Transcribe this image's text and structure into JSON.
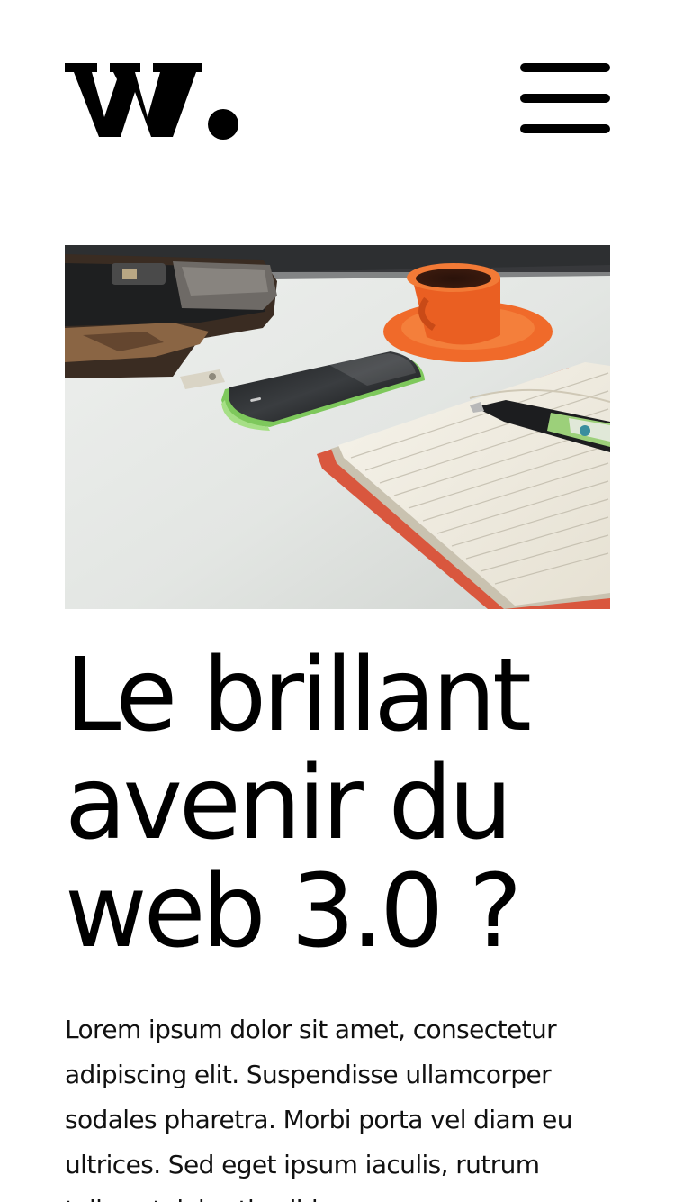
{
  "header": {
    "logo_letter": "W.",
    "menu_icon": "hamburger-menu-icon"
  },
  "hero": {
    "image_subject": "desk-flatlay-photo"
  },
  "article": {
    "title": "Le brillant avenir du web 3.0 ?",
    "body": "Lorem ipsum dolor sit amet, consectetur adipiscing elit. Suspendisse ullamcorper sodales pharetra. Morbi porta vel diam eu ultrices. Sed eget ipsum iaculis, rutrum tellus at, lobortis nibh."
  },
  "colors": {
    "background": "#ffffff",
    "text": "#000000",
    "cup": "#f06a2a",
    "phone": "#8fd46a",
    "notebook_cover": "#d9573e"
  }
}
